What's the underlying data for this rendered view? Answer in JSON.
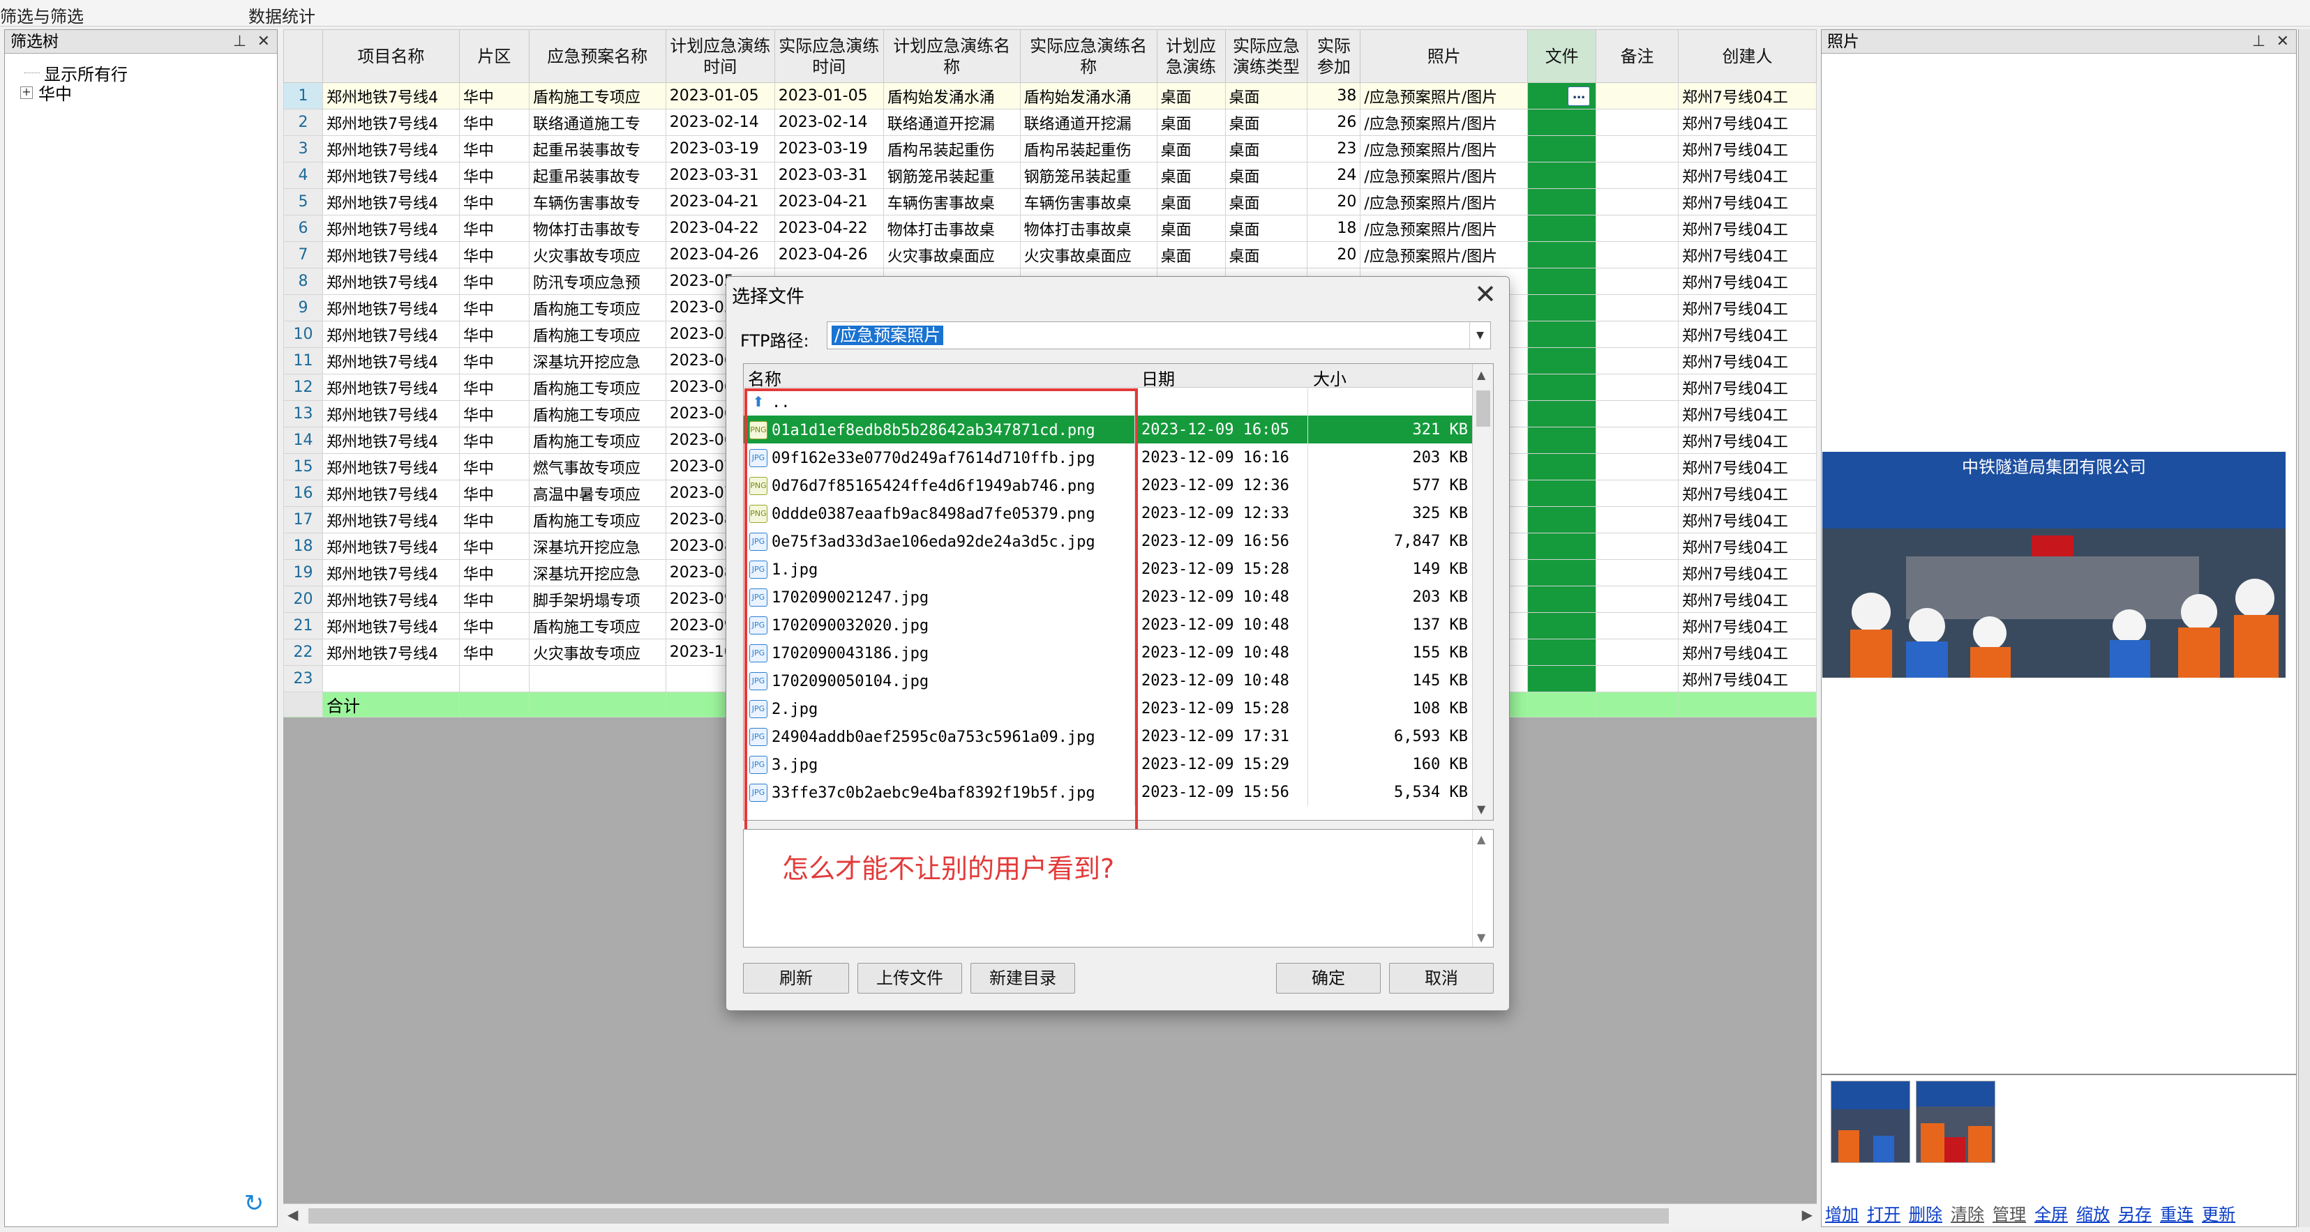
{
  "top_tabs": [
    "筛选与筛选",
    "数据统计"
  ],
  "filter_panel": {
    "title": "筛选树",
    "items": [
      {
        "label": "显示所有行"
      },
      {
        "label": "华中"
      }
    ]
  },
  "grid": {
    "columns": [
      "",
      "项目名称",
      "片区",
      "应急预案名称",
      "计划应急演练时间",
      "实际应急演练时间",
      "计划应急演练名称",
      "实际应急演练名称",
      "计划应急演练",
      "实际应急演练类型",
      "实际参加",
      "照片",
      "文件",
      "备注",
      "创建人"
    ],
    "rows": [
      [
        "1",
        "郑州地铁7号线4",
        "华中",
        "盾构施工专项应",
        "2023-01-05",
        "2023-01-05",
        "盾构始发涌水涌",
        "盾构始发涌水涌",
        "桌面",
        "桌面",
        "38",
        "/应急预案照片/图片",
        "",
        "",
        "郑州7号线04工"
      ],
      [
        "2",
        "郑州地铁7号线4",
        "华中",
        "联络通道施工专",
        "2023-02-14",
        "2023-02-14",
        "联络通道开挖漏",
        "联络通道开挖漏",
        "桌面",
        "桌面",
        "26",
        "/应急预案照片/图片",
        "",
        "",
        "郑州7号线04工"
      ],
      [
        "3",
        "郑州地铁7号线4",
        "华中",
        "起重吊装事故专",
        "2023-03-19",
        "2023-03-19",
        "盾构吊装起重伤",
        "盾构吊装起重伤",
        "桌面",
        "桌面",
        "23",
        "/应急预案照片/图片",
        "",
        "",
        "郑州7号线04工"
      ],
      [
        "4",
        "郑州地铁7号线4",
        "华中",
        "起重吊装事故专",
        "2023-03-31",
        "2023-03-31",
        "钢筋笼吊装起重",
        "钢筋笼吊装起重",
        "桌面",
        "桌面",
        "24",
        "/应急预案照片/图片",
        "",
        "",
        "郑州7号线04工"
      ],
      [
        "5",
        "郑州地铁7号线4",
        "华中",
        "车辆伤害事故专",
        "2023-04-21",
        "2023-04-21",
        "车辆伤害事故桌",
        "车辆伤害事故桌",
        "桌面",
        "桌面",
        "20",
        "/应急预案照片/图片",
        "",
        "",
        "郑州7号线04工"
      ],
      [
        "6",
        "郑州地铁7号线4",
        "华中",
        "物体打击事故专",
        "2023-04-22",
        "2023-04-22",
        "物体打击事故桌",
        "物体打击事故桌",
        "桌面",
        "桌面",
        "18",
        "/应急预案照片/图片",
        "",
        "",
        "郑州7号线04工"
      ],
      [
        "7",
        "郑州地铁7号线4",
        "华中",
        "火灾事故专项应",
        "2023-04-26",
        "2023-04-26",
        "火灾事故桌面应",
        "火灾事故桌面应",
        "桌面",
        "桌面",
        "20",
        "/应急预案照片/图片",
        "",
        "",
        "郑州7号线04工"
      ],
      [
        "8",
        "郑州地铁7号线4",
        "华中",
        "防汛专项应急预",
        "2023-05",
        "",
        "",
        "",
        "",
        "",
        "",
        "",
        "",
        "",
        "郑州7号线04工"
      ],
      [
        "9",
        "郑州地铁7号线4",
        "华中",
        "盾构施工专项应",
        "2023-05",
        "",
        "",
        "",
        "",
        "",
        "",
        "",
        "",
        "",
        "郑州7号线04工"
      ],
      [
        "10",
        "郑州地铁7号线4",
        "华中",
        "盾构施工专项应",
        "2023-05",
        "",
        "",
        "",
        "",
        "",
        "",
        "",
        "",
        "",
        "郑州7号线04工"
      ],
      [
        "11",
        "郑州地铁7号线4",
        "华中",
        "深基坑开挖应急",
        "2023-06",
        "",
        "",
        "",
        "",
        "",
        "",
        "",
        "",
        "",
        "郑州7号线04工"
      ],
      [
        "12",
        "郑州地铁7号线4",
        "华中",
        "盾构施工专项应",
        "2023-06",
        "",
        "",
        "",
        "",
        "",
        "",
        "",
        "",
        "",
        "郑州7号线04工"
      ],
      [
        "13",
        "郑州地铁7号线4",
        "华中",
        "盾构施工专项应",
        "2023-06",
        "",
        "",
        "",
        "",
        "",
        "",
        "",
        "",
        "",
        "郑州7号线04工"
      ],
      [
        "14",
        "郑州地铁7号线4",
        "华中",
        "盾构施工专项应",
        "2023-06",
        "",
        "",
        "",
        "",
        "",
        "",
        "",
        "",
        "",
        "郑州7号线04工"
      ],
      [
        "15",
        "郑州地铁7号线4",
        "华中",
        "燃气事故专项应",
        "2023-07",
        "",
        "",
        "",
        "",
        "",
        "",
        "",
        "",
        "",
        "郑州7号线04工"
      ],
      [
        "16",
        "郑州地铁7号线4",
        "华中",
        "高温中暑专项应",
        "2023-07",
        "",
        "",
        "",
        "",
        "",
        "",
        "",
        "",
        "",
        "郑州7号线04工"
      ],
      [
        "17",
        "郑州地铁7号线4",
        "华中",
        "盾构施工专项应",
        "2023-08",
        "",
        "",
        "",
        "",
        "",
        "",
        "",
        "",
        "",
        "郑州7号线04工"
      ],
      [
        "18",
        "郑州地铁7号线4",
        "华中",
        "深基坑开挖应急",
        "2023-08",
        "",
        "",
        "",
        "",
        "",
        "",
        "",
        "",
        "",
        "郑州7号线04工"
      ],
      [
        "19",
        "郑州地铁7号线4",
        "华中",
        "深基坑开挖应急",
        "2023-08",
        "",
        "",
        "",
        "",
        "",
        "",
        "",
        "",
        "",
        "郑州7号线04工"
      ],
      [
        "20",
        "郑州地铁7号线4",
        "华中",
        "脚手架坍塌专项",
        "2023-09",
        "",
        "",
        "",
        "",
        "",
        "",
        "",
        "",
        "",
        "郑州7号线04工"
      ],
      [
        "21",
        "郑州地铁7号线4",
        "华中",
        "盾构施工专项应",
        "2023-09",
        "",
        "",
        "",
        "",
        "",
        "",
        "",
        "",
        "",
        "郑州7号线04工"
      ],
      [
        "22",
        "郑州地铁7号线4",
        "华中",
        "火灾事故专项应",
        "2023-10",
        "",
        "",
        "",
        "",
        "",
        "",
        "",
        "",
        "",
        "郑州7号线04工"
      ],
      [
        "23",
        "",
        "",
        "",
        "",
        "",
        "",
        "",
        "",
        "",
        "",
        "",
        "",
        "",
        "郑州7号线04工"
      ]
    ],
    "total_label": "合计"
  },
  "photo_panel": {
    "title": "照片",
    "photo_banner": "中铁隧道局集团有限公司",
    "links": [
      "增加",
      "打开",
      "删除",
      "清除",
      "管理",
      "全屏",
      "缩放",
      "另存",
      "重连",
      "更新"
    ]
  },
  "dialog": {
    "title": "选择文件",
    "ftp_label": "FTP路径:",
    "ftp_path": "/应急预案照片",
    "headers": {
      "name": "名称",
      "date": "日期",
      "size": "大小"
    },
    "files": [
      {
        "name": "..",
        "date": "",
        "size": "",
        "type": "up"
      },
      {
        "name": "01a1d1ef8edb8b5b28642ab347871cd.png",
        "date": "2023-12-09  16:05",
        "size": "321  KB",
        "type": "png"
      },
      {
        "name": "09f162e33e0770d249af7614d710ffb.jpg",
        "date": "2023-12-09  16:16",
        "size": "203  KB",
        "type": "jpg"
      },
      {
        "name": "0d76d7f85165424ffe4d6f1949ab746.png",
        "date": "2023-12-09  12:36",
        "size": "577  KB",
        "type": "png"
      },
      {
        "name": "0ddde0387eaafb9ac8498ad7fe05379.png",
        "date": "2023-12-09  12:33",
        "size": "325  KB",
        "type": "png"
      },
      {
        "name": "0e75f3ad33d3ae106eda92de24a3d5c.jpg",
        "date": "2023-12-09  16:56",
        "size": "7,847  KB",
        "type": "jpg"
      },
      {
        "name": "1.jpg",
        "date": "2023-12-09  15:28",
        "size": "149  KB",
        "type": "jpg"
      },
      {
        "name": "1702090021247.jpg",
        "date": "2023-12-09  10:48",
        "size": "203  KB",
        "type": "jpg"
      },
      {
        "name": "1702090032020.jpg",
        "date": "2023-12-09  10:48",
        "size": "137  KB",
        "type": "jpg"
      },
      {
        "name": "1702090043186.jpg",
        "date": "2023-12-09  10:48",
        "size": "155  KB",
        "type": "jpg"
      },
      {
        "name": "1702090050104.jpg",
        "date": "2023-12-09  10:48",
        "size": "145  KB",
        "type": "jpg"
      },
      {
        "name": "2.jpg",
        "date": "2023-12-09  15:28",
        "size": "108  KB",
        "type": "jpg"
      },
      {
        "name": "24904addb0aef2595c0a753c5961a09.jpg",
        "date": "2023-12-09  17:31",
        "size": "6,593  KB",
        "type": "jpg"
      },
      {
        "name": "3.jpg",
        "date": "2023-12-09  15:29",
        "size": "160  KB",
        "type": "jpg"
      },
      {
        "name": "33ffe37c0b2aebc9e4baf8392f19b5f.jpg",
        "date": "2023-12-09  15:56",
        "size": "5,534  KB",
        "type": "jpg"
      }
    ],
    "comment": "怎么才能不让别的用户看到?",
    "buttons": {
      "refresh": "刷新",
      "upload": "上传文件",
      "new_dir": "新建目录",
      "ok": "确定",
      "cancel": "取消"
    }
  },
  "colors": {
    "selection_green": "#169b3c",
    "total_row_green": "#9cf59c",
    "annotation_red": "#e23a3a",
    "path_highlight": "#1a73d1"
  }
}
